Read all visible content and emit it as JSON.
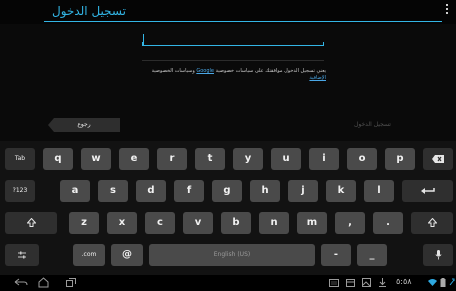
{
  "header": {
    "title": "تسجيل الدخول"
  },
  "password_field": {
    "value": ""
  },
  "terms": {
    "before": "يعني تسجيل الدخول موافقتك على سياسات خصوصية ",
    "google_link": "Google",
    "middle": " وسياسات الخصوصية ",
    "extra_link": "الإضافية"
  },
  "actions": {
    "back_label": "رجوع",
    "signin_label": "تسجيل الدخول"
  },
  "keyboard": {
    "row1": [
      "Tab",
      "q",
      "w",
      "e",
      "r",
      "t",
      "y",
      "u",
      "i",
      "o",
      "p"
    ],
    "row2": [
      "?123",
      "a",
      "s",
      "d",
      "f",
      "g",
      "h",
      "j",
      "k",
      "l"
    ],
    "row3": [
      "z",
      "x",
      "c",
      "v",
      "b",
      "n",
      "m",
      ",",
      "."
    ],
    "row4": [
      ".com",
      "@"
    ],
    "space_label": "English (US)",
    "dash_label": "-",
    "underscore_label": "_"
  },
  "status": {
    "time": "٥:٥٨",
    "colors": {
      "accent": "#33b5e5",
      "key": "#4a4a4a",
      "background": "#0a0a0a"
    }
  }
}
